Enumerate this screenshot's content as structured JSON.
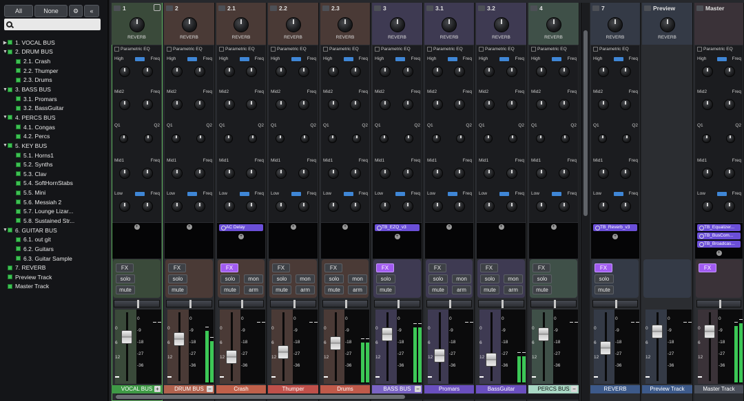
{
  "sidebar": {
    "all_label": "All",
    "none_label": "None",
    "search_placeholder": "",
    "tree": [
      {
        "label": "1. VOCAL BUS",
        "level": 0,
        "twisty": "▶"
      },
      {
        "label": "2. DRUM BUS",
        "level": 0,
        "twisty": "▼"
      },
      {
        "label": "2.1. Crash",
        "level": 1
      },
      {
        "label": "2.2. Thumper",
        "level": 1
      },
      {
        "label": "2.3. Drums",
        "level": 1
      },
      {
        "label": "3. BASS BUS",
        "level": 0,
        "twisty": "▼"
      },
      {
        "label": "3.1. Promars",
        "level": 1
      },
      {
        "label": "3.2. BassGuitar",
        "level": 1
      },
      {
        "label": "4. PERCS BUS",
        "level": 0,
        "twisty": "▼"
      },
      {
        "label": "4.1. Congas",
        "level": 1
      },
      {
        "label": "4.2. Percs",
        "level": 1
      },
      {
        "label": "5. KEY BUS",
        "level": 0,
        "twisty": "▼"
      },
      {
        "label": "5.1. Horns1",
        "level": 1
      },
      {
        "label": "5.2. Synths",
        "level": 1
      },
      {
        "label": "5.3. Clav",
        "level": 1
      },
      {
        "label": "5.4. SoftHornStabs",
        "level": 1
      },
      {
        "label": "5.5. Mini",
        "level": 1
      },
      {
        "label": "5.6. Messiah 2",
        "level": 1
      },
      {
        "label": "5.7. Lounge Lizar...",
        "level": 1
      },
      {
        "label": "5.8. Sustained Str...",
        "level": 1
      },
      {
        "label": "6. GUITAR BUS",
        "level": 0,
        "twisty": "▼"
      },
      {
        "label": "6.1. out git",
        "level": 1
      },
      {
        "label": "6.2. Guitars",
        "level": 1
      },
      {
        "label": "6.3. Guitar Sample",
        "level": 1
      },
      {
        "label": "7. REVERB",
        "level": 0
      },
      {
        "label": "Preview Track",
        "level": 0
      },
      {
        "label": "Master Track",
        "level": 0
      }
    ]
  },
  "mixer": {
    "labels": {
      "reverb": "REVERB",
      "eq_title": "Parametric EQ",
      "high": "High",
      "freq": "Freq",
      "mid2": "Mid2",
      "q1": "Q1",
      "q2": "Q2",
      "mid1": "Mid1",
      "low": "Low",
      "fx": "FX",
      "solo": "solo",
      "mute": "mute",
      "mon": "mon",
      "arm": "arm",
      "plus": "+",
      "minus": "−",
      "scale": [
        "0",
        "6",
        "12",
        "-"
      ],
      "meter_scale": [
        "0",
        "-9",
        "-18",
        "-27",
        "-36"
      ]
    },
    "colors": {
      "track_bg": "#2b2d31",
      "header_bg": "#3a3c42"
    },
    "strips": [
      {
        "id": "s1",
        "num": "1",
        "name": "VOCAL BUS",
        "name_color": "#3f9a46",
        "bg": "#3a4a3a",
        "selected": true,
        "fx_on": false,
        "has_rec": false,
        "fader_pos": 0.33,
        "meter": [
          0.0,
          0.0
        ],
        "plugins": [],
        "name_btn": "+"
      },
      {
        "id": "s2",
        "num": "2",
        "name": "DRUM BUS",
        "name_color": "#b0624e",
        "bg": "#4a3a36",
        "fx_on": false,
        "has_rec": false,
        "fader_pos": 0.36,
        "meter": [
          0.75,
          0.6
        ],
        "plugins": [],
        "name_btn": "−"
      },
      {
        "id": "s21",
        "num": "2.1",
        "name": "Crash",
        "name_color": "#c0604a",
        "bg": "#4a3a36",
        "fx_on": true,
        "has_rec": true,
        "fader_pos": 0.64,
        "meter": [
          0.0,
          0.0
        ],
        "plugins": [
          "AC Delay"
        ]
      },
      {
        "id": "s22",
        "num": "2.2",
        "name": "Thumper",
        "name_color": "#c0504a",
        "bg": "#4a3a36",
        "fx_on": false,
        "has_rec": true,
        "fader_pos": 0.57,
        "meter": [
          0.0,
          0.0
        ],
        "plugins": []
      },
      {
        "id": "s23",
        "num": "2.3",
        "name": "Drums",
        "name_color": "#c05a4a",
        "bg": "#4a3a36",
        "fx_on": false,
        "has_rec": true,
        "fader_pos": 0.42,
        "meter": [
          0.58,
          0.58
        ],
        "plugins": []
      },
      {
        "id": "s3",
        "num": "3",
        "name": "BASS BUS",
        "name_color": "#7a64c4",
        "bg": "#3e3a52",
        "fx_on": true,
        "has_rec": false,
        "fader_pos": 0.28,
        "meter": [
          0.8,
          0.8
        ],
        "plugins": [
          "TB_EZQ_v3"
        ],
        "name_btn": "−"
      },
      {
        "id": "s31",
        "num": "3.1",
        "name": "Promars",
        "name_color": "#6a4fbf",
        "bg": "#3e3a52",
        "fx_on": false,
        "has_rec": true,
        "fader_pos": 0.62,
        "meter": [
          0.0,
          0.0
        ],
        "plugins": []
      },
      {
        "id": "s32",
        "num": "3.2",
        "name": "BassGuitar",
        "name_color": "#6a4fbf",
        "bg": "#3e3a52",
        "fx_on": false,
        "has_rec": true,
        "fader_pos": 0.68,
        "meter": [
          0.38,
          0.38
        ],
        "plugins": []
      },
      {
        "id": "s4",
        "num": "4",
        "name": "PERCS BUS",
        "name_color": "#a9d8c5",
        "bg": "#3f5048",
        "fx_on": false,
        "has_rec": false,
        "fader_pos": 0.28,
        "meter": [
          0.0,
          0.0
        ],
        "plugins": [],
        "name_btn": "−",
        "name_text_color": "#111"
      },
      {
        "id": "s7",
        "num": "7",
        "name": "REVERB",
        "name_color": "#3d5a8a",
        "bg": "#343a46",
        "fx_on": true,
        "has_rec": false,
        "fader_pos": 0.5,
        "meter": [
          0.0,
          0.0
        ],
        "plugins": [
          "TB_Reverb_v3"
        ]
      },
      {
        "id": "sp",
        "num": "Preview",
        "name": "Preview Track",
        "name_color": "#3d5a8a",
        "bg": "#343a46",
        "fx_on": false,
        "no_ctl": true,
        "fader_pos": 0.24,
        "meter": [
          0.0,
          0.0
        ],
        "plugins": []
      },
      {
        "id": "sm",
        "num": "Master",
        "name": "Master Track",
        "name_color": "#4a4f5a",
        "bg": "#3a3238",
        "fx_on": true,
        "no_sm": true,
        "fader_pos": 0.24,
        "meter": [
          0.82,
          0.86
        ],
        "plugins": [
          "TB_Equalizer...",
          "TB_BusCom...",
          "TB_Broadcas..."
        ]
      }
    ]
  }
}
